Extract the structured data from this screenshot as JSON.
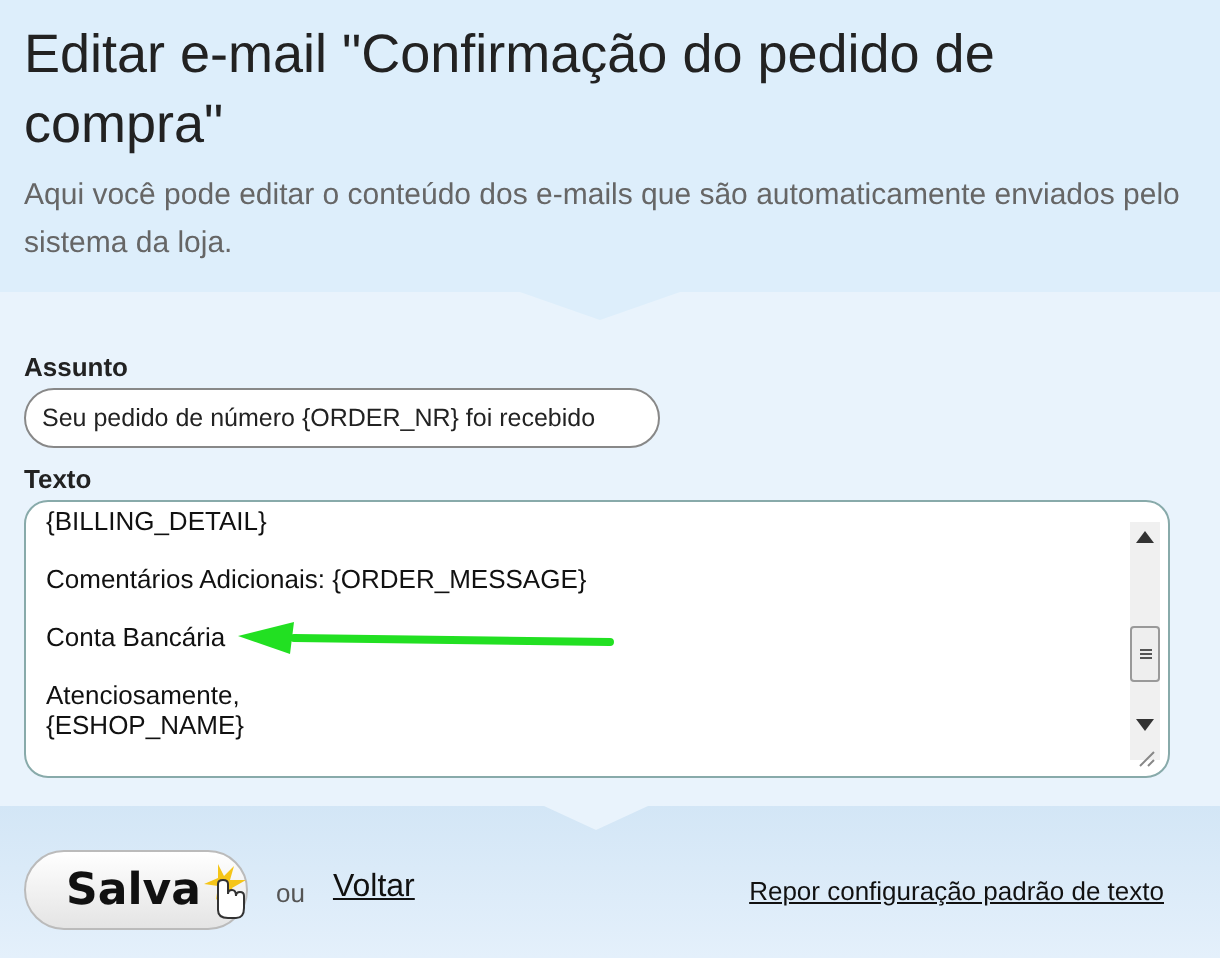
{
  "header": {
    "title": "Editar e-mail \"Confirmação do pedido de compra\"",
    "subtitle": "Aqui você pode editar o conteúdo dos e-mails que são automaticamente enviados pelo sistema da loja."
  },
  "subject": {
    "label": "Assunto",
    "value": "Seu pedido de número {ORDER_NR} foi recebido"
  },
  "body": {
    "label": "Texto",
    "paragraphs": [
      [
        "{BILLING_DETAIL}"
      ],
      [
        "Comentários Adicionais: {ORDER_MESSAGE}"
      ],
      [
        "Conta Bancária"
      ],
      [
        "Atenciosamente,",
        "{ESHOP_NAME}"
      ]
    ]
  },
  "footer": {
    "save_button": "Salva",
    "separator": "ou",
    "back_link": "Voltar",
    "reset_link": "Repor configuração padrão de texto"
  }
}
